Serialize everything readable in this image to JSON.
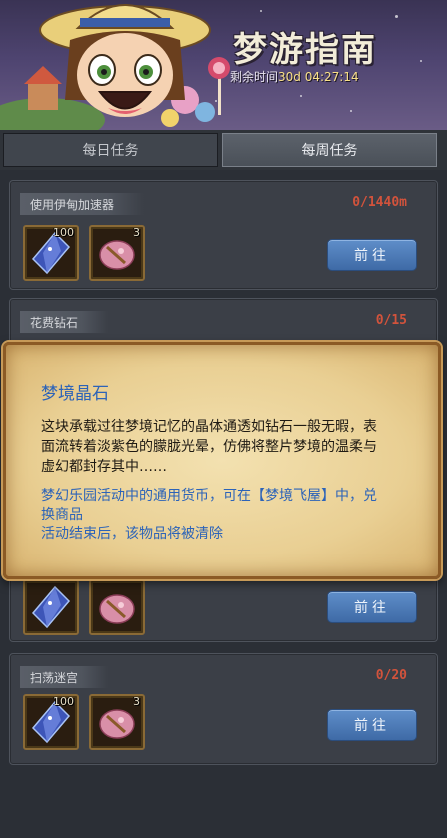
{
  "header": {
    "title": "梦游指南",
    "timer_label": "剩余时间",
    "timer_value": "30d 04:27:14"
  },
  "tabs": [
    {
      "label": "每日任务",
      "active": false
    },
    {
      "label": "每周任务",
      "active": true
    }
  ],
  "tasks": [
    {
      "label": "使用伊甸加速器",
      "progress": "0/1440m",
      "rewards": [
        {
          "name": "dream-crystal",
          "count": "100"
        },
        {
          "name": "pink-gem",
          "count": "3"
        }
      ],
      "button": "前往"
    },
    {
      "label": "花费钻石",
      "progress": "0/15",
      "rewards": [],
      "button": ""
    },
    {
      "label": "",
      "progress": "",
      "rewards": [
        {
          "name": "dream-crystal",
          "count": ""
        },
        {
          "name": "pink-gem",
          "count": ""
        }
      ],
      "button": "前往"
    },
    {
      "label": "扫荡迷宫",
      "progress": "0/20",
      "rewards": [
        {
          "name": "dream-crystal",
          "count": "100"
        },
        {
          "name": "pink-gem",
          "count": "3"
        }
      ],
      "button": "前往"
    }
  ],
  "tooltip": {
    "title": "梦境晶石",
    "description": "这块承载过往梦境记忆的晶体通透如钻石一般无暇，表面流转着淡紫色的朦胧光晕，仿佛将整片梦境的温柔与虚幻都封存其中……",
    "note_line1": "梦幻乐园活动中的通用货币，可在【梦境飞屋】中，兑换商品",
    "note_line2": "活动结束后，该物品将被清除"
  },
  "colors": {
    "progress_red": "#d2533c",
    "button_blue": "#4a78b5",
    "tooltip_title_blue": "#2c63b8",
    "timer_yellow": "#f9e087"
  }
}
